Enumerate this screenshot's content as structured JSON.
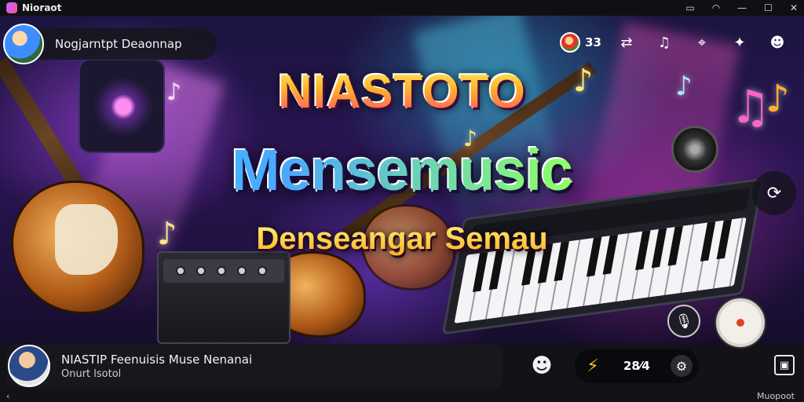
{
  "window": {
    "title": "Nioraot",
    "icons": [
      "screen-icon",
      "wifi-icon",
      "minimize-icon",
      "maximize-icon",
      "close-icon"
    ],
    "icon_glyphs": {
      "screen": "▭",
      "wifi": "◠",
      "minimize": "—",
      "maximize": "☐",
      "close": "✕"
    }
  },
  "channel": {
    "name": "Nogjarntpt Deaonnap"
  },
  "top_actions": {
    "viewer_count": "33",
    "icons": [
      "shuffle-icon",
      "music-note-icon",
      "pin-icon",
      "gift-icon",
      "profile-icon"
    ],
    "glyphs": {
      "shuffle": "⇄",
      "note": "♫",
      "pin": "⌖",
      "gift": "✦",
      "profile": "☻"
    }
  },
  "banner": {
    "title": "NIASTOTO",
    "subtitle": "Mensemusic",
    "tagline": "Denseangar Semau"
  },
  "side_button_glyph": "⟳",
  "mic_glyph": "🎙",
  "now_playing": {
    "title": "NIASTIP Feenuisis Muse Nenanai",
    "subtitle": "Onurt lsotol"
  },
  "controls": {
    "mascot_glyph": "☻",
    "bolt_glyph": "⚡",
    "bolt_value": "28⁄4",
    "settings_glyph": "⚙",
    "save_glyph": "▣"
  },
  "footer": {
    "right_text": "Muopoot",
    "left_mark": "‹"
  },
  "colors": {
    "accent_yellow": "#ffc21a",
    "record_red": "#e0431f",
    "bar_bg": "#121217"
  }
}
